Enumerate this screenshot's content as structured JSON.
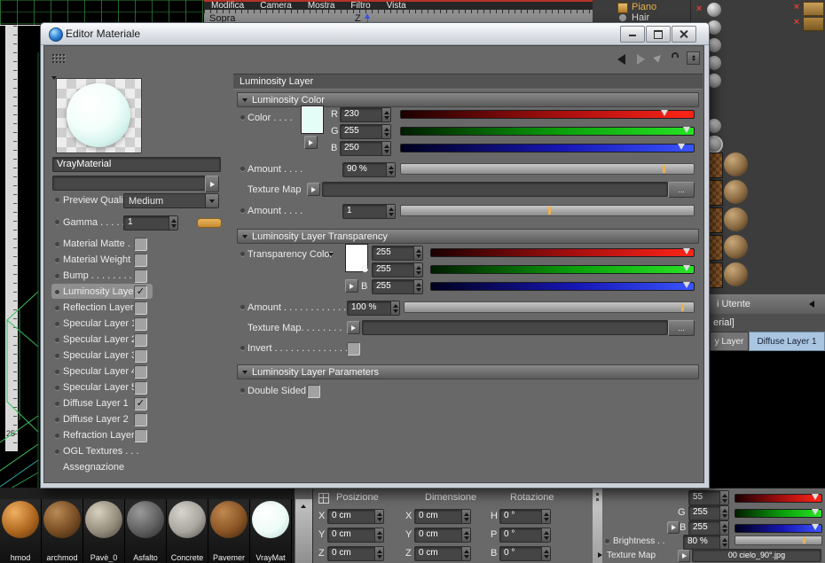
{
  "bg": {
    "menu_items": [
      "Modifica",
      "Camera",
      "Mostra",
      "Filtro",
      "Vista"
    ],
    "viewport_label": "Sopra",
    "axis_label": "Z",
    "ruler_value": "25",
    "outliner": {
      "item1": "Piano",
      "item2": "Hair"
    },
    "marks": [
      "×",
      "×",
      "×",
      "×",
      "×",
      "✓",
      ""
    ],
    "corner_marks": [
      "×",
      "×"
    ],
    "panel": {
      "title": "i Utente",
      "subtitle": "erial]",
      "tab1": "y Layer",
      "tab2": "Diffuse Layer 1"
    },
    "thumbnails": [
      {
        "name": "hmod"
      },
      {
        "name": "archmod"
      },
      {
        "name": "Pavè_0"
      },
      {
        "name": "Asfalto"
      },
      {
        "name": "Concrete"
      },
      {
        "name": "Pavemer"
      },
      {
        "name": "VrayMat"
      }
    ],
    "coords": {
      "headers": [
        "Posizione",
        "Dimensione",
        "Rotazione"
      ],
      "rows": [
        {
          "l1": "X",
          "v1": "0 cm",
          "l2": "X",
          "v2": "0 cm",
          "l3": "H",
          "v3": "0 °"
        },
        {
          "l1": "Y",
          "v1": "0 cm",
          "l2": "Y",
          "v2": "0 cm",
          "l3": "P",
          "v3": "0 °"
        },
        {
          "l1": "Z",
          "v1": "0 cm",
          "l2": "Z",
          "v2": "0 cm",
          "l3": "B",
          "v3": "0 °"
        }
      ]
    },
    "shader": {
      "r_value": "55",
      "g_label": "G",
      "g_value": "255",
      "b_label": "B",
      "b_value": "255",
      "brightness_label": "Brightness . .",
      "brightness_value": "80 %",
      "texture_label": "Texture Map",
      "texture_value": "00 cielo_90°.jpg"
    }
  },
  "dialog": {
    "title": "Editor Materiale",
    "left": {
      "material_name": "VrayMaterial",
      "preview_quality_label": "Preview Quality",
      "preview_quality_value": "Medium",
      "gamma_label": "Gamma . . . . . .",
      "gamma_value": "1",
      "channels": [
        {
          "label": "Material Matte . .",
          "check": ""
        },
        {
          "label": "Material Weight",
          "check": ""
        },
        {
          "label": "Bump . . . . . . . . .",
          "check": ""
        },
        {
          "label": "Luminosity Layer",
          "check": "✓"
        },
        {
          "label": "Reflection Layer",
          "check": ""
        },
        {
          "label": "Specular Layer 1",
          "check": ""
        },
        {
          "label": "Specular Layer 2",
          "check": ""
        },
        {
          "label": "Specular Layer 3",
          "check": ""
        },
        {
          "label": "Specular Layer 4",
          "check": ""
        },
        {
          "label": "Specular Layer 5",
          "check": ""
        },
        {
          "label": "Diffuse Layer 1",
          "check": "✓"
        },
        {
          "label": "Diffuse Layer 2",
          "check": ""
        },
        {
          "label": "Refraction Layer",
          "check": ""
        },
        {
          "label": "OGL Textures . . ."
        },
        {
          "label": "Assegnazione"
        }
      ]
    },
    "content": {
      "header": "Luminosity Layer",
      "browse": "...",
      "lum": {
        "section": "Luminosity Color",
        "color_label": "Color . . . .",
        "r_label": "R",
        "r": "230",
        "g_label": "G",
        "g": "255",
        "b_label": "B",
        "b": "250",
        "amount_label": "Amount . . . .",
        "amount": "90 %",
        "texture_label": "Texture Map",
        "amount2_label": "Amount . . . .",
        "amount2": "1"
      },
      "transp": {
        "section": "Luminosity Layer Transparency",
        "color_label": "Transparency Color",
        "r": "255",
        "g_label": "G",
        "g": "255",
        "b_label": "B",
        "b": "255",
        "amount_label": "Amount . . . . . . . . . . . .",
        "amount": "100 %",
        "texture_label": "Texture Map. . . . . . . .",
        "invert_label": "Invert . . . . . . . . . . . . . ."
      },
      "params": {
        "section": "Luminosity Layer Parameters",
        "double_sided_label": "Double Sided"
      }
    },
    "colors": {
      "lum_swatch": "#e4fdf6",
      "transp_swatch": "#ffffff",
      "tab_active": "#a9c5e2"
    }
  }
}
